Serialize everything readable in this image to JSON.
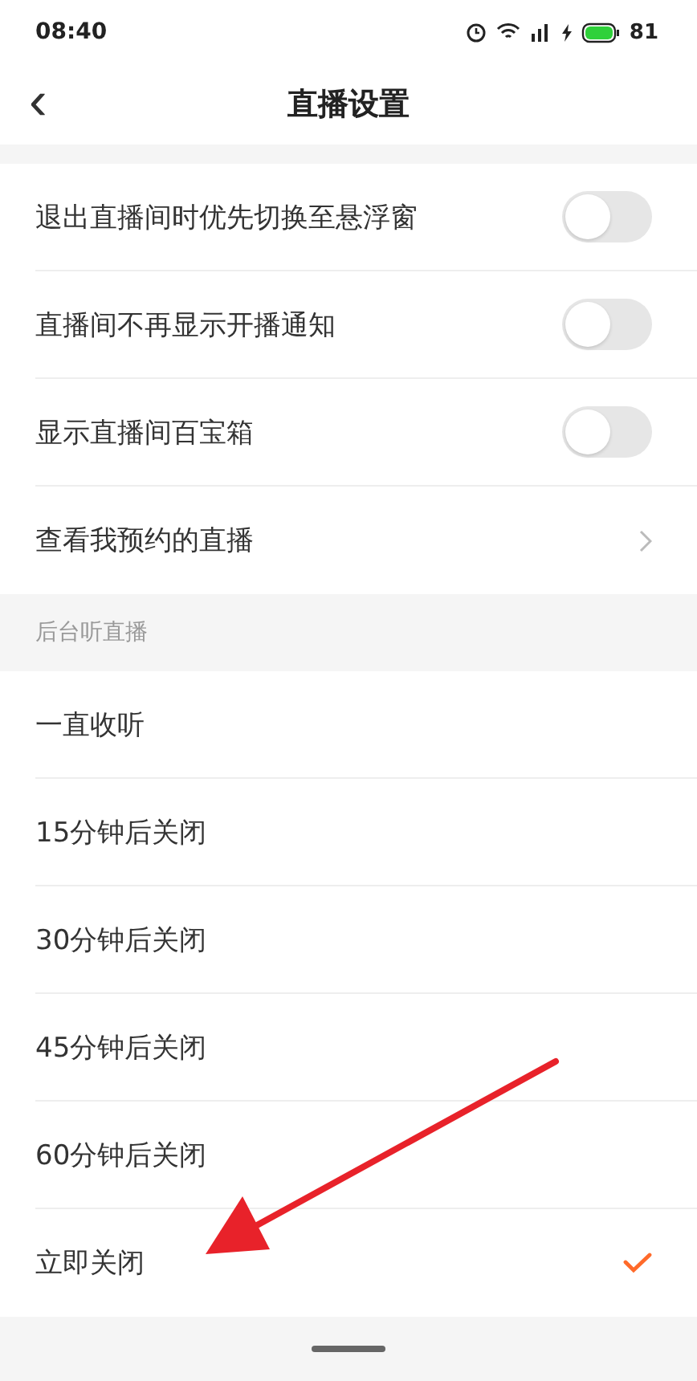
{
  "status_bar": {
    "time": "08:40",
    "battery": "81"
  },
  "header": {
    "back": "‹",
    "title": "直播设置"
  },
  "settings": [
    {
      "kind": "toggle",
      "label": "退出直播间时优先切换至悬浮窗",
      "on": false
    },
    {
      "kind": "toggle",
      "label": "直播间不再显示开播通知",
      "on": false
    },
    {
      "kind": "toggle",
      "label": "显示直播间百宝箱",
      "on": false
    },
    {
      "kind": "link",
      "label": "查看我预约的直播"
    }
  ],
  "section": {
    "title": "后台听直播"
  },
  "options": [
    {
      "label": "一直收听",
      "selected": false
    },
    {
      "label": "15分钟后关闭",
      "selected": false
    },
    {
      "label": "30分钟后关闭",
      "selected": false
    },
    {
      "label": "45分钟后关闭",
      "selected": false
    },
    {
      "label": "60分钟后关闭",
      "selected": false
    },
    {
      "label": "立即关闭",
      "selected": true
    }
  ]
}
